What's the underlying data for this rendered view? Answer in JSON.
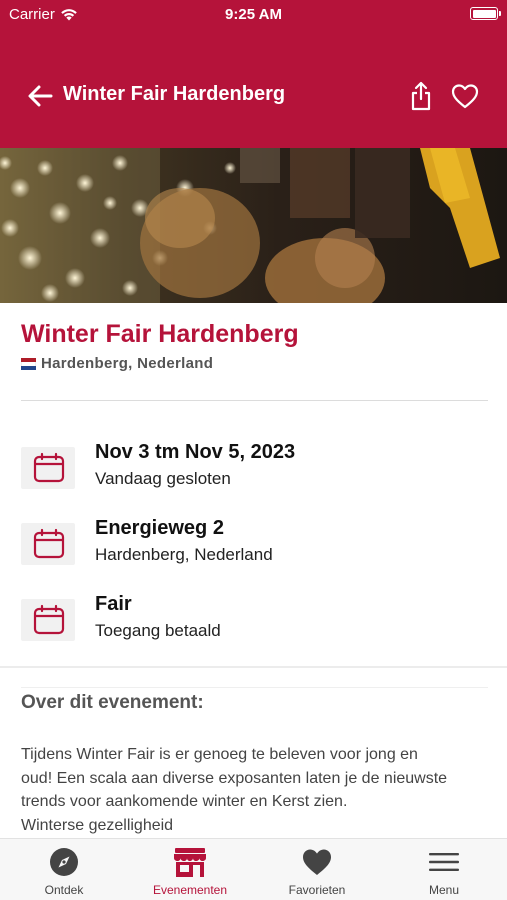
{
  "status_bar": {
    "carrier": "Carrier",
    "time": "9:25 AM"
  },
  "nav": {
    "title": "Winter Fair Hardenberg"
  },
  "event": {
    "title": "Winter Fair Hardenberg",
    "location": "Hardenberg, Nederland"
  },
  "info_rows": [
    {
      "main": "Nov 3 tm Nov 5, 2023",
      "sub": "Vandaag gesloten"
    },
    {
      "main": "Energieweg 2",
      "sub": "Hardenberg, Nederland"
    },
    {
      "main": "Fair",
      "sub": "Toegang betaald"
    }
  ],
  "about": {
    "title": "Over dit evenement:",
    "lines": [
      "Tijdens Winter Fair is er genoeg te beleven voor jong en",
      "oud! Een scala aan diverse exposanten laten je de nieuwste",
      "trends voor aankomende winter en Kerst zien.",
      "Winterse gezelligheid"
    ]
  },
  "tabs": [
    {
      "label": "Ontdek",
      "icon": "compass-icon",
      "active": false
    },
    {
      "label": "Evenementen",
      "icon": "store-icon",
      "active": true
    },
    {
      "label": "Favorieten",
      "icon": "heart-icon",
      "active": false
    },
    {
      "label": "Menu",
      "icon": "hamburger-menu-icon",
      "active": false
    }
  ],
  "colors": {
    "brand": "#b5133a",
    "tab_inactive": "#444444"
  }
}
